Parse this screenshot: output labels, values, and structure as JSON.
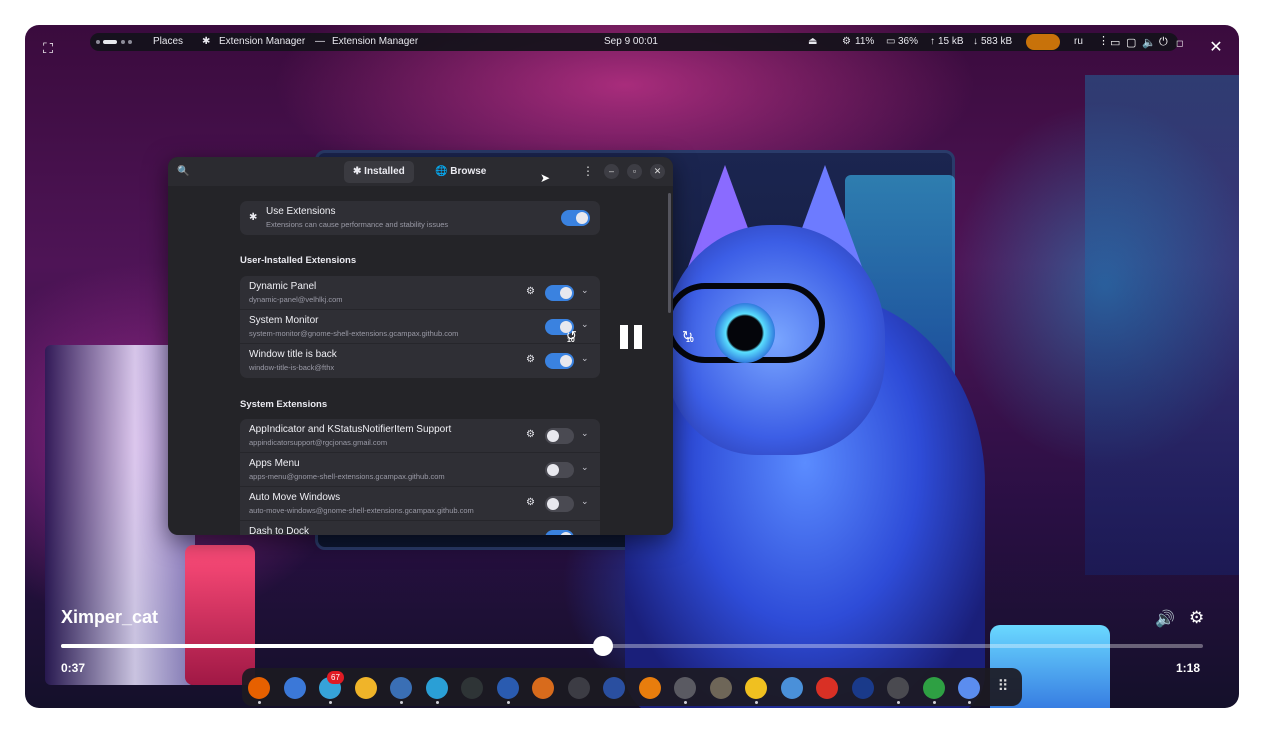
{
  "topbar": {
    "places": "Places",
    "app_name": "Extension Manager",
    "separator": "—",
    "window_title": "Extension Manager",
    "datetime": "Sep 9  00:01",
    "cpu": "11%",
    "mem": "36%",
    "upload": "15 kB",
    "download": "583 kB",
    "lang": "ru"
  },
  "window": {
    "tabs": {
      "installed": "Installed",
      "browse": "Browse"
    },
    "use_extensions": {
      "title": "Use Extensions",
      "subtitle": "Extensions can cause performance and stability issues",
      "enabled": true
    },
    "user_section_title": "User-Installed Extensions",
    "user_extensions": [
      {
        "name": "Dynamic Panel",
        "uuid": "dynamic-panel@velhlkj.com",
        "enabled": true,
        "has_settings": true
      },
      {
        "name": "System Monitor",
        "uuid": "system-monitor@gnome-shell-extensions.gcampax.github.com",
        "enabled": true,
        "has_settings": false
      },
      {
        "name": "Window title is back",
        "uuid": "window-title-is-back@fthx",
        "enabled": true,
        "has_settings": true
      }
    ],
    "system_section_title": "System Extensions",
    "system_extensions": [
      {
        "name": "AppIndicator and KStatusNotifierItem Support",
        "uuid": "appindicatorsupport@rgcjonas.gmail.com",
        "enabled": false,
        "has_settings": true
      },
      {
        "name": "Apps Menu",
        "uuid": "apps-menu@gnome-shell-extensions.gcampax.github.com",
        "enabled": false,
        "has_settings": false
      },
      {
        "name": "Auto Move Windows",
        "uuid": "auto-move-windows@gnome-shell-extensions.gcampax.github.com",
        "enabled": false,
        "has_settings": true
      },
      {
        "name": "Dash to Dock",
        "uuid": "",
        "enabled": true,
        "has_settings": false
      }
    ]
  },
  "player": {
    "title": "Ximper_cat",
    "current_time": "0:37",
    "total_time": "1:18",
    "progress_fraction": 0.4744,
    "skip_back": "10",
    "skip_forward": "10"
  },
  "dock": {
    "badge": "67",
    "apps": [
      {
        "name": "firefox-icon",
        "color": "#e66000",
        "running": true
      },
      {
        "name": "chromium-icon",
        "color": "#3b78d8",
        "running": false
      },
      {
        "name": "telegram-icon",
        "color": "#36a3d9",
        "running": true
      },
      {
        "name": "colors-app-icon",
        "color": "#f0b429",
        "running": false
      },
      {
        "name": "files-icon",
        "color": "#3a6fb5",
        "running": true
      },
      {
        "name": "maps-icon",
        "color": "#2a9fd6",
        "running": true
      },
      {
        "name": "terminal-icon",
        "color": "#2e3436",
        "running": false
      },
      {
        "name": "toggle-app-icon",
        "color": "#2a5bb0",
        "running": true
      },
      {
        "name": "apps-grid-icon",
        "color": "#d86b1c",
        "running": false
      },
      {
        "name": "screenshot-icon",
        "color": "#3c3c44",
        "running": false
      },
      {
        "name": "monitor-icon",
        "color": "#2a4fa0",
        "running": false
      },
      {
        "name": "blender-icon",
        "color": "#e87d0d",
        "running": false
      },
      {
        "name": "inkscape-icon",
        "color": "#5a5a62",
        "running": true
      },
      {
        "name": "gimp-icon",
        "color": "#6e6658",
        "running": false
      },
      {
        "name": "darktable-icon",
        "color": "#f0c020",
        "running": true
      },
      {
        "name": "shield-icon",
        "color": "#4a90d9",
        "running": false
      },
      {
        "name": "chrome-icon",
        "color": "#d93025",
        "running": false
      },
      {
        "name": "bluetooth-app-icon",
        "color": "#1a3a8a",
        "running": false
      },
      {
        "name": "tweaks-icon",
        "color": "#4a4a50",
        "running": true
      },
      {
        "name": "music-icon",
        "color": "#2ea043",
        "running": true
      },
      {
        "name": "extensions-icon",
        "color": "#5b8def",
        "running": true
      }
    ]
  }
}
